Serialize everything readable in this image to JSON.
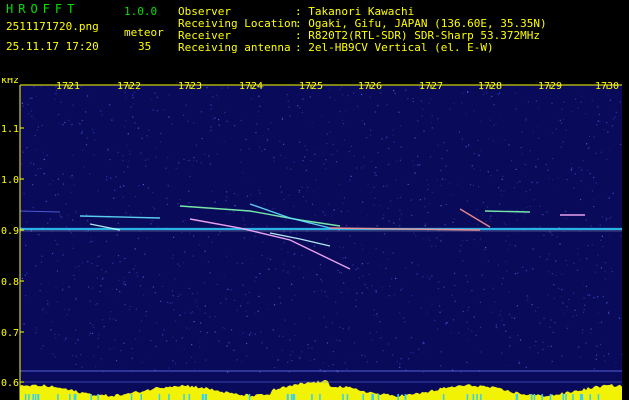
{
  "header": {
    "brand": "HROFFT",
    "version": "1.0.0",
    "filename": "2511171720.png",
    "meteor_label": "meteor",
    "datetime": "25.11.17 17:20",
    "meteor_count": "35",
    "info": [
      {
        "key": "Observer",
        "value": ": Takanori Kawachi"
      },
      {
        "key": "Receiving Location",
        "value": ": Ogaki, Gifu, JAPAN (136.60E, 35.35N)"
      },
      {
        "key": "Receiver",
        "value": ": R820T2(RTL-SDR) SDR-Sharp 53.372MHz"
      },
      {
        "key": "Receiving antenna",
        "value": ": 2el-HB9CV Vertical (el. E-W)"
      }
    ]
  },
  "spectrogram": {
    "unit_label": "kHz",
    "time_ticks": [
      "1721",
      "1722",
      "1723",
      "1724",
      "1725",
      "1726",
      "1727",
      "1728",
      "1729",
      "1730"
    ],
    "freq_ticks": [
      "1.1",
      "1.0",
      "0.9",
      "0.8",
      "0.7",
      "0.6"
    ],
    "background_color": "#0a0a5a",
    "carrier_color": "#30d0ff",
    "meter_color": "#ffff00"
  }
}
